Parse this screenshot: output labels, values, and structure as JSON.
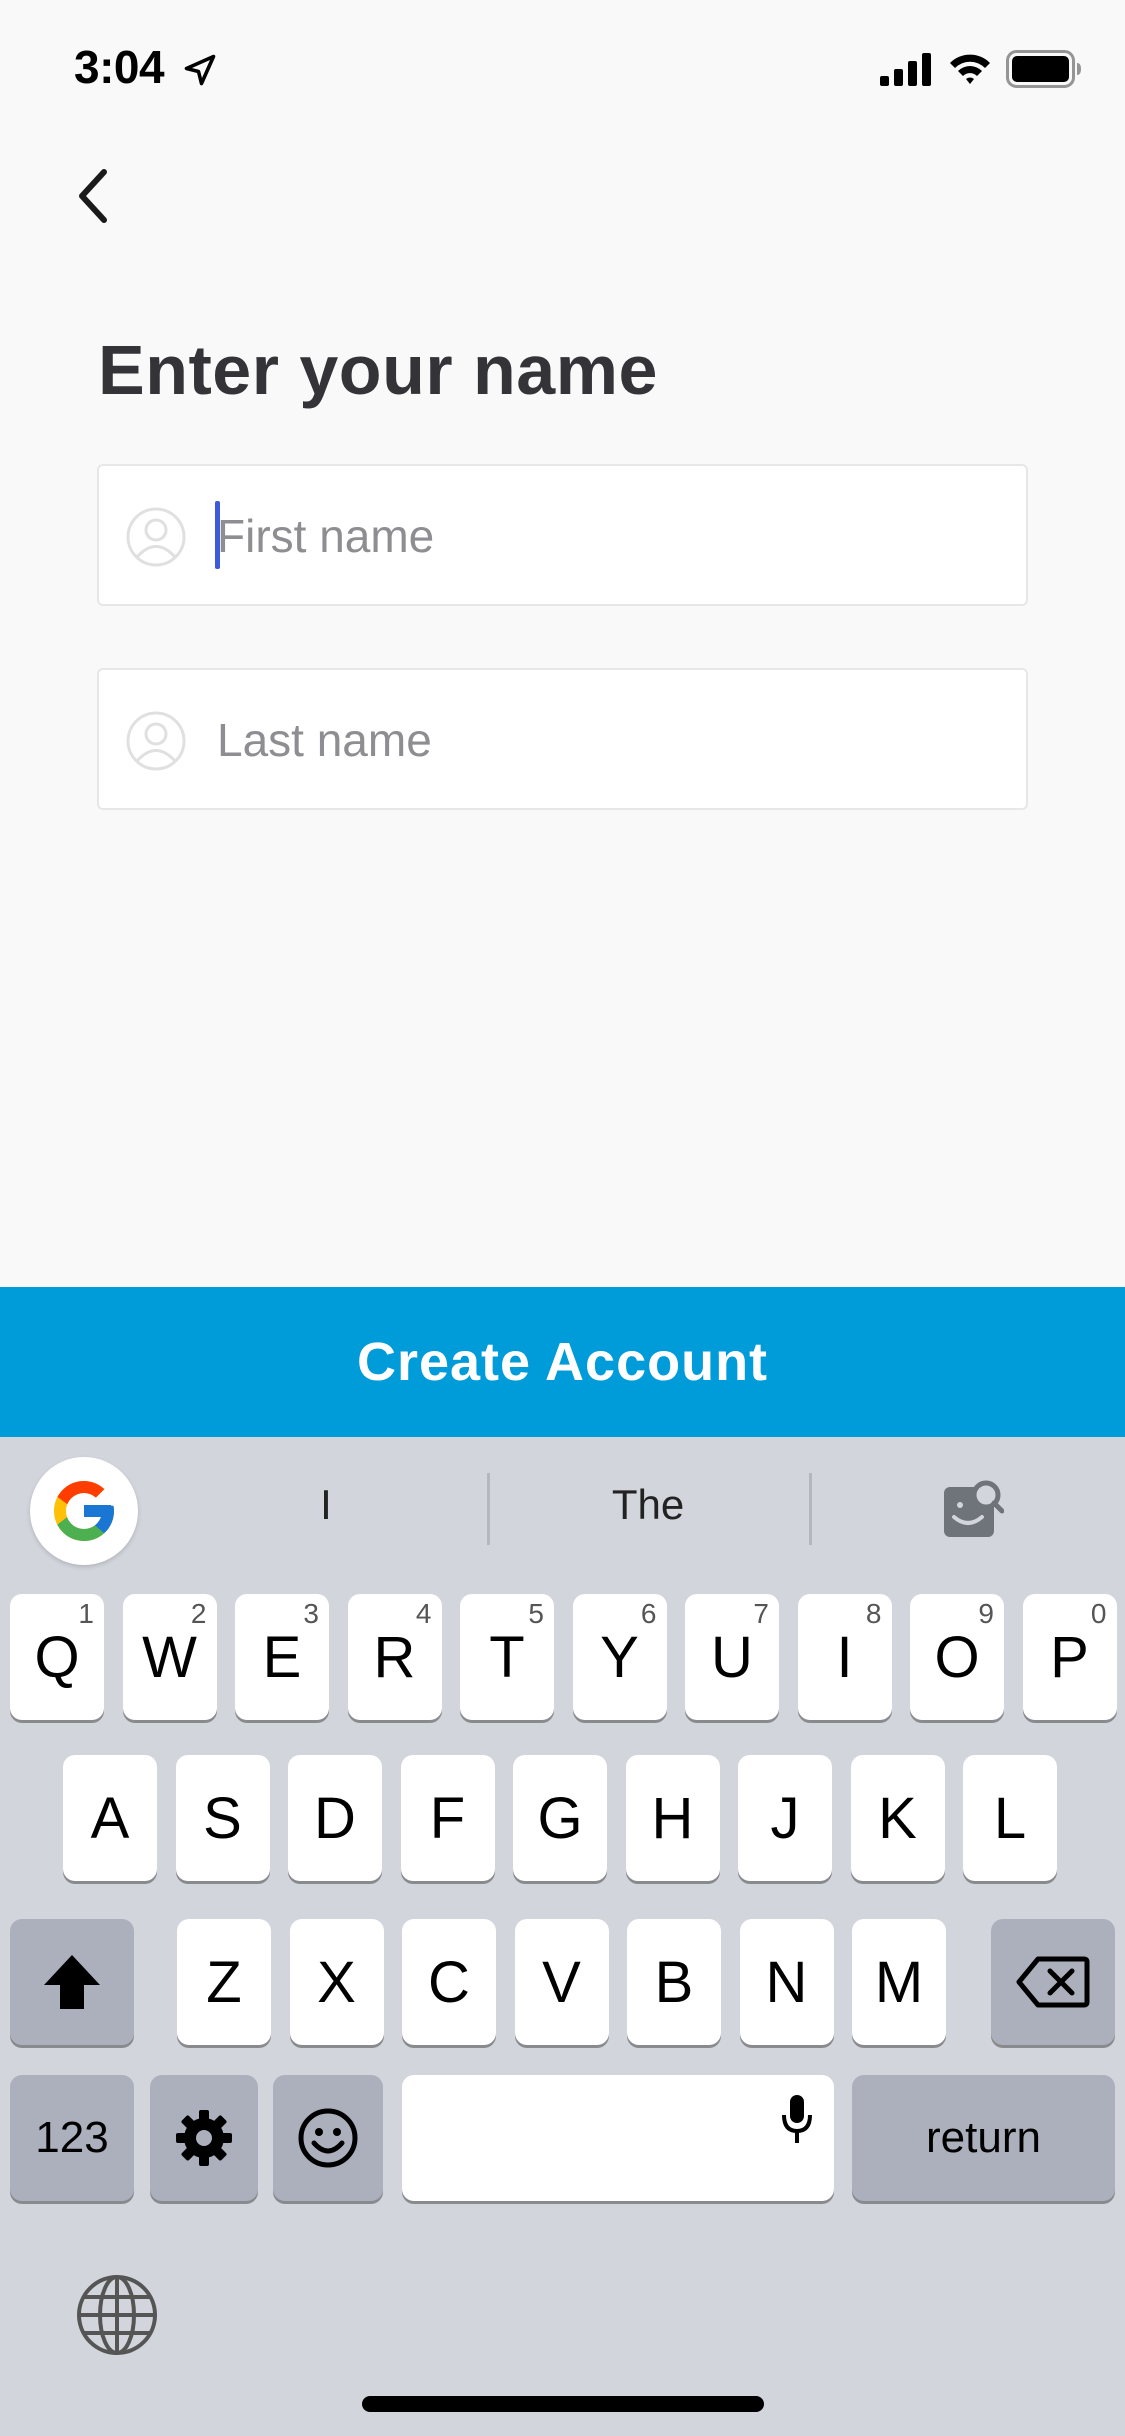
{
  "status": {
    "time": "3:04"
  },
  "page": {
    "title": "Enter your name"
  },
  "form": {
    "first_name": {
      "placeholder": "First name",
      "value": ""
    },
    "last_name": {
      "placeholder": "Last name",
      "value": ""
    }
  },
  "actions": {
    "create_account": "Create Account"
  },
  "colors": {
    "accent": "#009cd9",
    "caret": "#3b5bdb",
    "background": "#f9f9f9"
  },
  "keyboard": {
    "suggestions": [
      "I",
      "The"
    ],
    "row1": [
      {
        "label": "Q",
        "num": "1"
      },
      {
        "label": "W",
        "num": "2"
      },
      {
        "label": "E",
        "num": "3"
      },
      {
        "label": "R",
        "num": "4"
      },
      {
        "label": "T",
        "num": "5"
      },
      {
        "label": "Y",
        "num": "6"
      },
      {
        "label": "U",
        "num": "7"
      },
      {
        "label": "I",
        "num": "8"
      },
      {
        "label": "O",
        "num": "9"
      },
      {
        "label": "P",
        "num": "0"
      }
    ],
    "row2": [
      "A",
      "S",
      "D",
      "F",
      "G",
      "H",
      "J",
      "K",
      "L"
    ],
    "row3": [
      "Z",
      "X",
      "C",
      "V",
      "B",
      "N",
      "M"
    ],
    "numbers_key": "123",
    "return_key": "return"
  }
}
